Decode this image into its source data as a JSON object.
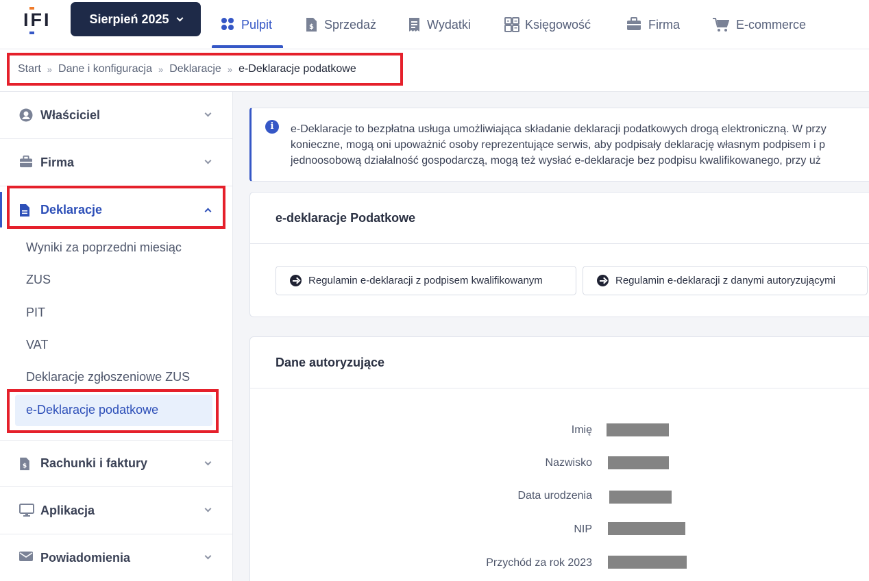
{
  "topnav": {
    "logo_text": "IFI",
    "month_label": "Sierpień 2025",
    "items": [
      {
        "label": "Pulpit",
        "icon": "dashboard-dots-icon",
        "active": true
      },
      {
        "label": "Sprzedaż",
        "icon": "invoice-dollar-icon",
        "active": false
      },
      {
        "label": "Wydatki",
        "icon": "receipt-icon",
        "active": false
      },
      {
        "label": "Księgowość",
        "icon": "calculator-icon",
        "active": false
      },
      {
        "label": "Firma",
        "icon": "briefcase-icon",
        "active": false
      },
      {
        "label": "E-commerce",
        "icon": "cart-icon",
        "active": false
      }
    ]
  },
  "breadcrumb": {
    "items": [
      "Start",
      "Dane i konfiguracja",
      "Deklaracje",
      "e-Deklaracje podatkowe"
    ],
    "separator": "»"
  },
  "sidebar": {
    "groups": [
      {
        "label": "Właściciel",
        "icon": "user-circle-icon"
      },
      {
        "label": "Firma",
        "icon": "briefcase-icon"
      },
      {
        "label": "Deklaracje",
        "icon": "document-icon",
        "open": true
      },
      {
        "label": "Rachunki i faktury",
        "icon": "invoice-dollar-icon"
      },
      {
        "label": "Aplikacja",
        "icon": "monitor-icon"
      },
      {
        "label": "Powiadomienia",
        "icon": "envelope-icon"
      }
    ],
    "deklaracje_items": [
      "Wyniki za poprzedni miesiąc",
      "ZUS",
      "PIT",
      "VAT",
      "Deklaracje zgłoszeniowe ZUS",
      "e-Deklaracje podatkowe"
    ],
    "active_item": "e-Deklaracje podatkowe"
  },
  "info": {
    "icon": "info-icon",
    "line1": "e-Deklaracje to bezpłatna usługa umożliwiająca składanie deklaracji podatkowych drogą elektroniczną. W przy",
    "line2": "konieczne, mogą oni upoważnić osoby reprezentujące serwis, aby podpisały deklarację własnym podpisem i p",
    "line3": "jednoosobową działalność gospodarczą, mogą też wysłać e-deklaracje bez podpisu kwalifikowanego, przy uż"
  },
  "card1": {
    "title": "e-deklaracje Podatkowe",
    "button1": "Regulamin e-deklaracji z podpisem kwalifikowanym",
    "button2": "Regulamin e-deklaracji z danymi autoryzującymi"
  },
  "card2": {
    "title": "Dane autoryzujące",
    "fields": [
      {
        "label": "Imię",
        "value": ""
      },
      {
        "label": "Nazwisko",
        "value": ""
      },
      {
        "label": "Data urodzenia",
        "value": ""
      },
      {
        "label": "NIP",
        "value": ""
      },
      {
        "label": "Przychód za rok 2023",
        "value": ""
      }
    ],
    "redaction_color": "#848484"
  },
  "colors": {
    "accent": "#3557c6",
    "dark": "#1e2a48",
    "highlight": "#e5202b"
  }
}
